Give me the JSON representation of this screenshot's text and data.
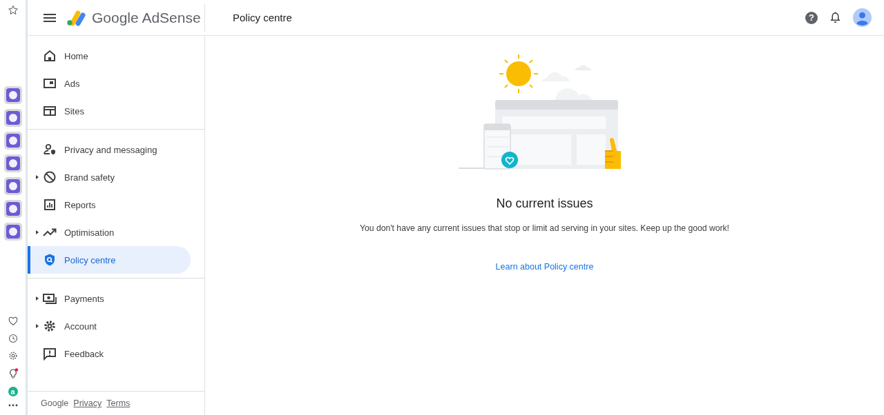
{
  "browser_sidebar": {
    "badge_letter": "a"
  },
  "header": {
    "product": "Google AdSense",
    "page_title": "Policy centre",
    "help_glyph": "?"
  },
  "nav": {
    "sections": [
      [
        {
          "label": "Home",
          "expandable": false,
          "selected": false
        },
        {
          "label": "Ads",
          "expandable": false,
          "selected": false
        },
        {
          "label": "Sites",
          "expandable": false,
          "selected": false
        }
      ],
      [
        {
          "label": "Privacy and messaging",
          "expandable": false,
          "selected": false
        },
        {
          "label": "Brand safety",
          "expandable": true,
          "selected": false
        },
        {
          "label": "Reports",
          "expandable": false,
          "selected": false
        },
        {
          "label": "Optimisation",
          "expandable": true,
          "selected": false
        },
        {
          "label": "Policy centre",
          "expandable": false,
          "selected": true
        }
      ],
      [
        {
          "label": "Payments",
          "expandable": true,
          "selected": false
        },
        {
          "label": "Account",
          "expandable": true,
          "selected": false
        },
        {
          "label": "Feedback",
          "expandable": false,
          "selected": false
        }
      ]
    ]
  },
  "footer": {
    "brand": "Google",
    "links": [
      "Privacy",
      "Terms"
    ]
  },
  "content": {
    "title": "No current issues",
    "message": "You don't have any current issues that stop or limit ad serving in your sites. Keep up the good work!",
    "link": "Learn about Policy centre"
  }
}
